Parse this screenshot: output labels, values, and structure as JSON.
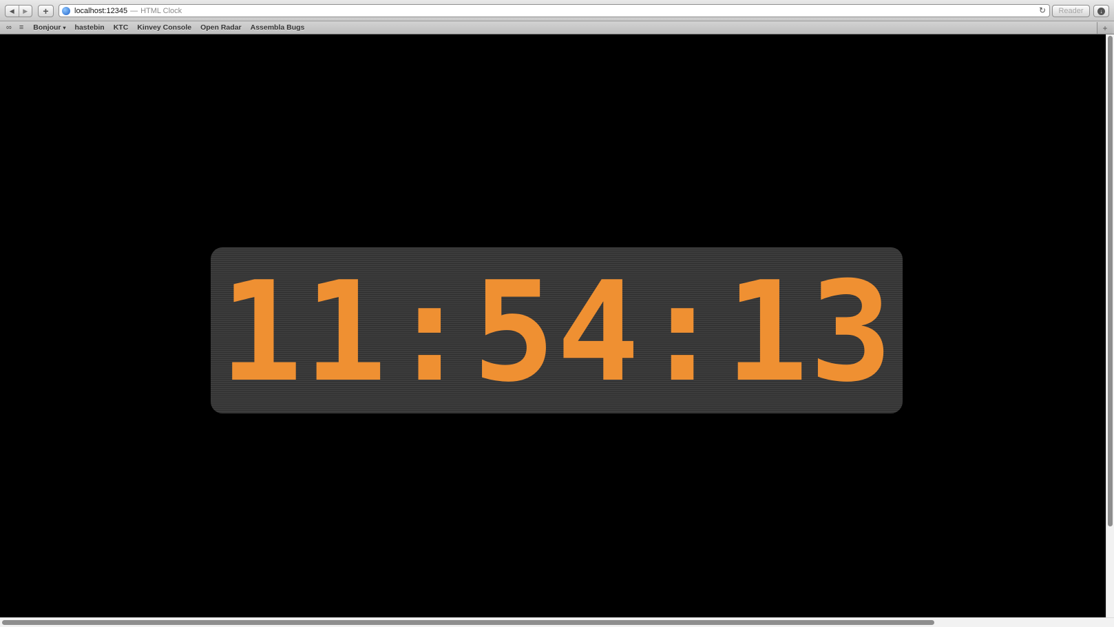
{
  "browser": {
    "url_host": "localhost:12345",
    "url_separator": "—",
    "page_title": "HTML Clock",
    "reader_label": "Reader",
    "back_icon": "◀",
    "forward_icon": "▶",
    "add_icon": "+",
    "reload_icon": "↻",
    "download_icon": "↓"
  },
  "bookmarks": {
    "reading_list_icon": "∞",
    "bookmarks_icon": "≡",
    "items": [
      {
        "label": "Bonjour",
        "caret": "▾"
      },
      {
        "label": "hastebin"
      },
      {
        "label": "KTC"
      },
      {
        "label": "Kinvey Console"
      },
      {
        "label": "Open Radar"
      },
      {
        "label": "Assembla Bugs"
      }
    ],
    "new_tab_icon": "+"
  },
  "clock": {
    "time": "11:54:13",
    "digit_color": "#ef9032",
    "panel_color": "#383838"
  }
}
